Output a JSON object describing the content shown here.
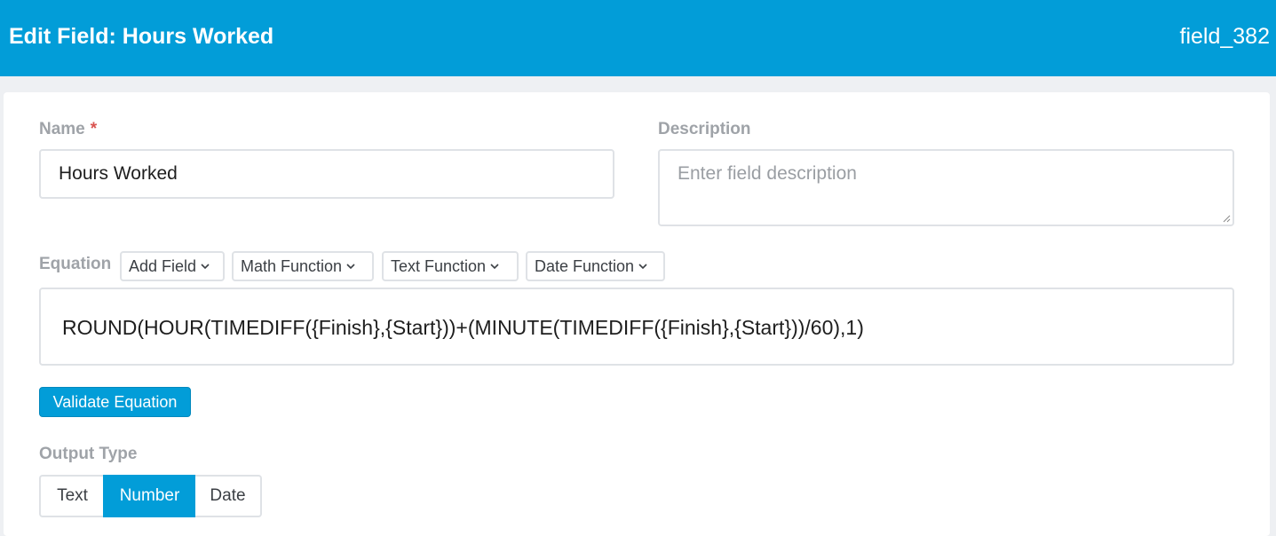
{
  "header": {
    "title": "Edit Field: Hours Worked",
    "field_id": "field_382"
  },
  "form": {
    "name_label": "Name",
    "name_required_marker": "*",
    "name_value": "Hours Worked",
    "description_label": "Description",
    "description_placeholder": "Enter field description",
    "equation_label": "Equation",
    "equation_menus": [
      {
        "label": "Add Field"
      },
      {
        "label": "Math Function"
      },
      {
        "label": "Text Function"
      },
      {
        "label": "Date Function"
      }
    ],
    "equation_value": "ROUND(HOUR(TIMEDIFF({Finish},{Start}))+(MINUTE(TIMEDIFF({Finish},{Start}))/60),1)",
    "validate_label": "Validate Equation",
    "output_type_label": "Output Type",
    "output_types": [
      {
        "label": "Text"
      },
      {
        "label": "Number"
      },
      {
        "label": "Date"
      }
    ],
    "output_type_selected": "Number"
  },
  "colors": {
    "accent": "#029dd8",
    "required": "#d9534f"
  }
}
